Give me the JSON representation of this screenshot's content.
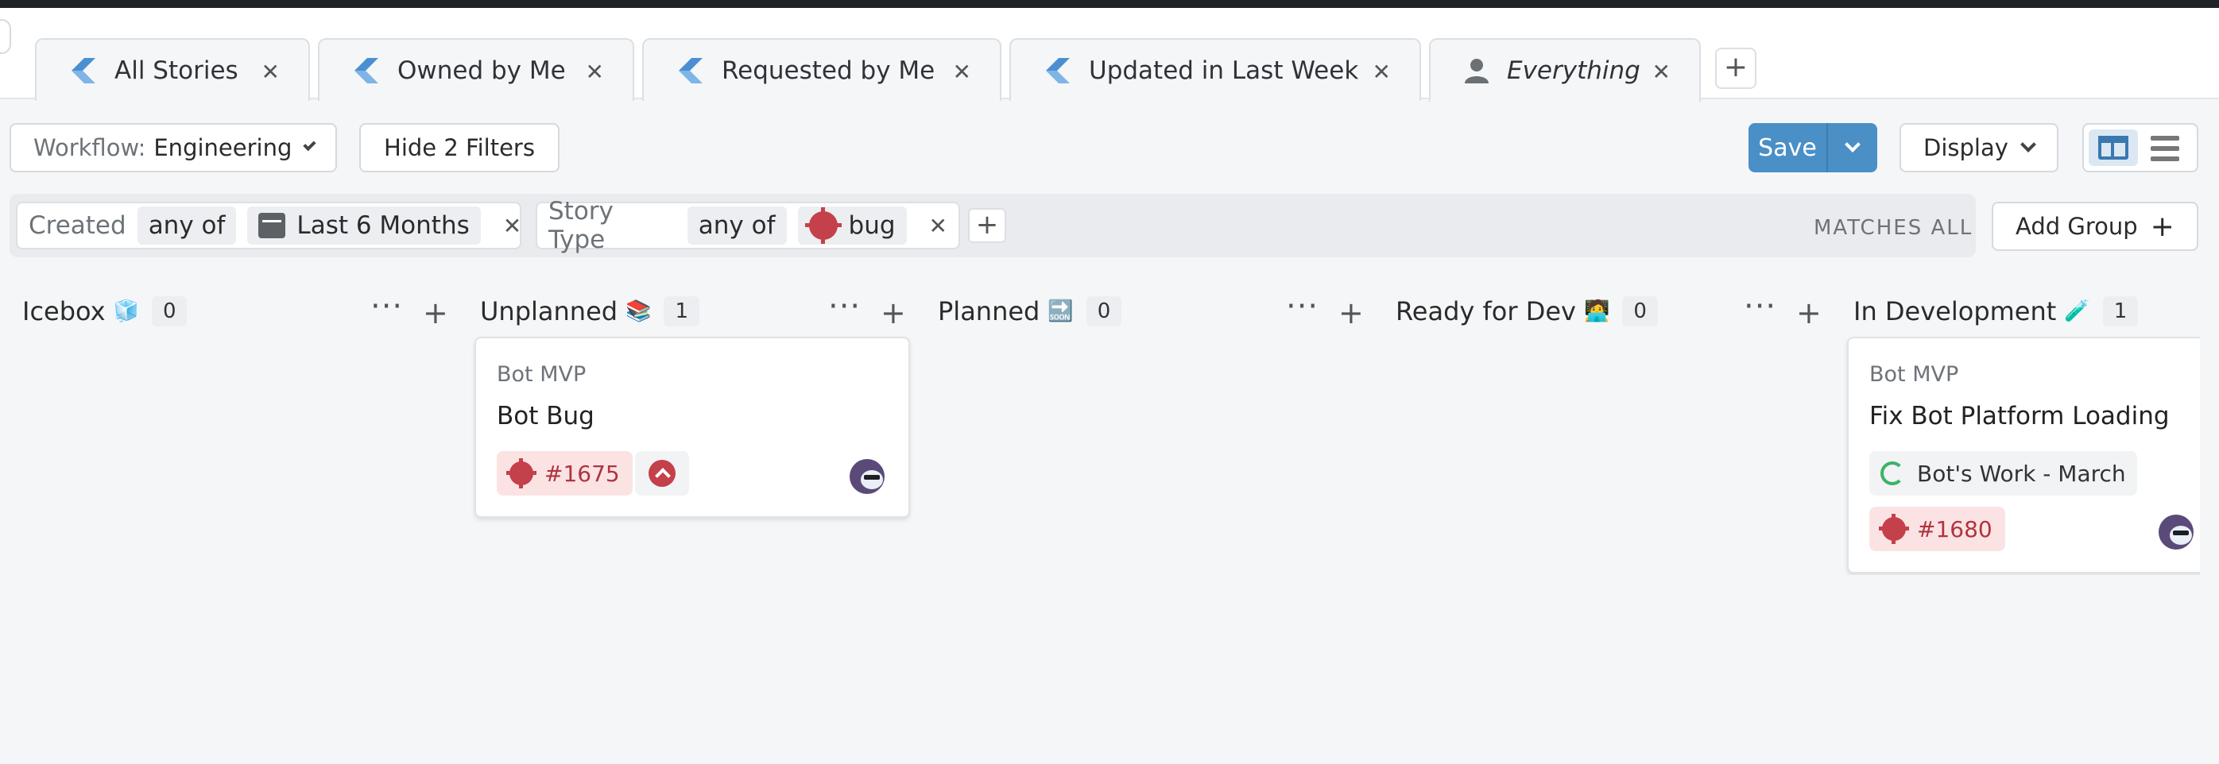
{
  "tabs": [
    {
      "label": "All Stories",
      "icon": "shortcut-logo-icon"
    },
    {
      "label": "Owned by Me",
      "icon": "shortcut-logo-icon"
    },
    {
      "label": "Requested by Me",
      "icon": "shortcut-logo-icon"
    },
    {
      "label": "Updated in Last Week",
      "icon": "shortcut-logo-icon"
    },
    {
      "label": "Everything",
      "icon": "user-icon",
      "active": true
    }
  ],
  "toolbar": {
    "workflow_label": "Workflow:",
    "workflow_value": "Engineering",
    "hide_filters": "Hide 2 Filters",
    "save": "Save",
    "display": "Display"
  },
  "filters": {
    "created": {
      "field": "Created",
      "op": "any of",
      "value": "Last 6 Months"
    },
    "story_type": {
      "field": "Story Type",
      "op": "any of",
      "value": "bug"
    },
    "matches": "MATCHES ALL",
    "add_group": "Add Group"
  },
  "columns": [
    {
      "name": "Icebox",
      "emoji": "🧊",
      "count": "0"
    },
    {
      "name": "Unplanned",
      "emoji": "📚",
      "count": "1"
    },
    {
      "name": "Planned",
      "emoji": "🔜",
      "count": "0"
    },
    {
      "name": "Ready for Dev",
      "emoji": "🧑‍💻",
      "count": "0"
    },
    {
      "name": "In Development",
      "emoji": "🧪",
      "count": "1"
    }
  ],
  "cards": [
    {
      "epic": "Bot MVP",
      "title": "Bot Bug",
      "story_id": "#1675"
    },
    {
      "epic": "Bot MVP",
      "title": "Fix Bot Platform Loading",
      "iteration": "Bot's Work - March",
      "story_id": "#1680"
    }
  ],
  "colors": {
    "accent": "#4b8fc7",
    "bug": "#c4404a",
    "iteration": "#3bb36a"
  }
}
